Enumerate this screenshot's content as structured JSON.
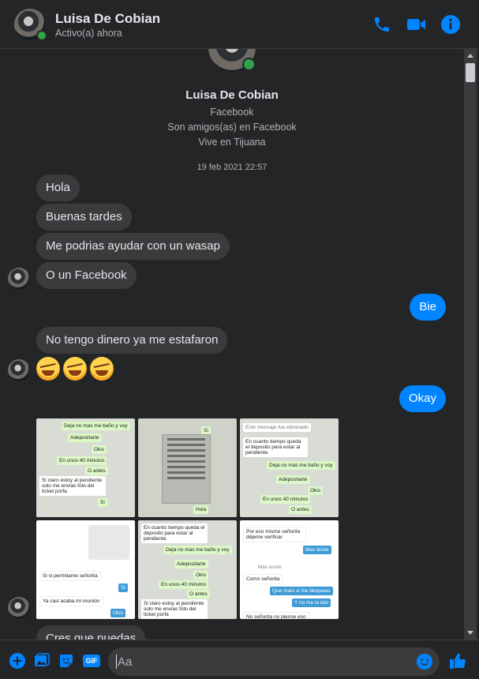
{
  "header": {
    "name": "Luisa De Cobian",
    "status": "Activo(a) ahora"
  },
  "profile": {
    "name": "Luisa De Cobian",
    "source": "Facebook",
    "friendship": "Son amigos(as) en Facebook",
    "location": "Vive en Tijuana"
  },
  "timestamp": "19 feb 2021 22:57",
  "messages": [
    {
      "text": "Hola",
      "from": "them"
    },
    {
      "text": "Buenas tardes",
      "from": "them"
    },
    {
      "text": "Me podrias ayudar con un wasap",
      "from": "them"
    },
    {
      "text": "O un Facebook",
      "from": "them"
    },
    {
      "text": "Bie",
      "from": "me"
    },
    {
      "text": "No tengo dinero ya me estafaron",
      "from": "them"
    },
    {
      "text": "Okay",
      "from": "me"
    },
    {
      "text": "Cres que puedas",
      "from": "them"
    }
  ],
  "photos": {
    "p1": [
      "Deja no mas me baño y voy",
      "Adepositarte",
      "Okis",
      "En unos 40 minutos",
      "O antes",
      "Si claro estoy al pendiente solo me envias foto del ticket porfa",
      "Si"
    ],
    "p2": [
      "Si",
      "Hola"
    ],
    "p3": [
      "Este mensaje fue eliminado",
      "En cuanto tiempo queda el deposito para estar al pendiente",
      "Deja no mas me baño y voy",
      "Adepositarte",
      "Okis",
      "En unos 40 minutos",
      "O antes"
    ],
    "p4": [
      "Si si permitame señorita",
      "Si",
      "Ya casi acaba mi reunión",
      "Okis"
    ],
    "p5": [
      "En cuanto tiempo queda el deposito para estar al pendiente",
      "Deja no mas me baño y voy",
      "Adepositarte",
      "Okis",
      "En unos 40 minutos",
      "O antes",
      "Si claro estoy al pendiente solo me envias foto del ticket porfa"
    ],
    "p6": [
      "Por eso mismo señorita déjeme verificar",
      "Mas teiste",
      "Mas teiste",
      "Como señorita",
      "Que malo si me bloqueas",
      "Y no me la das",
      "No señorita no piense eso"
    ]
  },
  "composer": {
    "placeholder": "Aa"
  },
  "icons": {
    "header": [
      "phone-icon",
      "video-icon",
      "info-icon"
    ],
    "footer": [
      "add-icon",
      "image-icon",
      "sticker-icon",
      "gif-icon",
      "emoji-icon",
      "like-icon"
    ]
  },
  "colors": {
    "accent": "#0084ff",
    "background": "#242526",
    "bubble_in": "#3a3b3c",
    "online": "#31a24c"
  }
}
